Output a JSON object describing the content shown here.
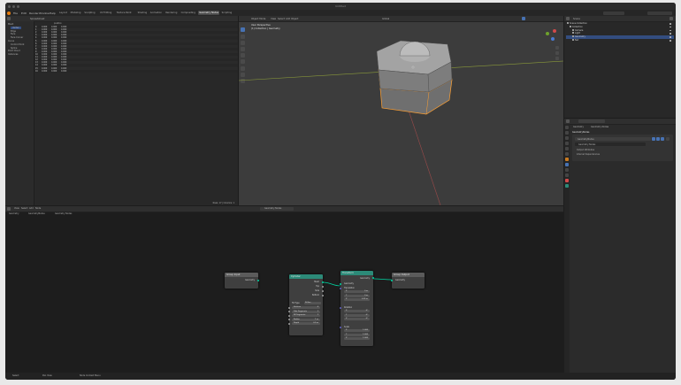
{
  "window": {
    "title": "Untitled"
  },
  "menu": [
    "File",
    "Edit",
    "Render",
    "Window",
    "Help"
  ],
  "workspaces": [
    "Layout",
    "Modeling",
    "Sculpting",
    "UV Editing",
    "Texture Paint",
    "Shading",
    "Animation",
    "Rendering",
    "Compositing",
    "Geometry Nodes",
    "Scripting"
  ],
  "active_workspace": "Geometry Nodes",
  "spreadsheet": {
    "header": "Spreadsheet",
    "items": [
      {
        "label": "Mesh",
        "indent": 0
      },
      {
        "label": "Vertex",
        "indent": 1
      },
      {
        "label": "Edge",
        "indent": 1
      },
      {
        "label": "Face",
        "indent": 1
      },
      {
        "label": "Face Corner",
        "indent": 1
      },
      {
        "label": "Curve",
        "indent": 0
      },
      {
        "label": "Control Point",
        "indent": 1
      },
      {
        "label": "Spline",
        "indent": 1
      },
      {
        "label": "Point Cloud",
        "indent": 0
      },
      {
        "label": "Instances",
        "indent": 0
      }
    ],
    "column_header": "position",
    "rows": [
      [
        "0",
        "0.000",
        "0.000",
        "0.000"
      ],
      [
        "1",
        "0.000",
        "0.000",
        "0.000"
      ],
      [
        "2",
        "0.000",
        "0.000",
        "0.000"
      ],
      [
        "3",
        "0.000",
        "0.000",
        "0.000"
      ],
      [
        "4",
        "0.000",
        "0.000",
        "0.000"
      ],
      [
        "5",
        "0.000",
        "0.000",
        "0.000"
      ],
      [
        "6",
        "0.000",
        "0.000",
        "0.000"
      ],
      [
        "7",
        "0.000",
        "0.000",
        "0.000"
      ],
      [
        "8",
        "0.000",
        "0.000",
        "0.000"
      ],
      [
        "9",
        "0.000",
        "0.000",
        "0.000"
      ],
      [
        "10",
        "0.000",
        "0.000",
        "0.000"
      ],
      [
        "11",
        "0.000",
        "0.000",
        "0.000"
      ],
      [
        "12",
        "0.000",
        "0.000",
        "0.000"
      ],
      [
        "13",
        "0.000",
        "0.000",
        "0.000"
      ],
      [
        "14",
        "0.000",
        "0.000",
        "0.000"
      ],
      [
        "15",
        "0.000",
        "0.000",
        "0.000"
      ],
      [
        "16",
        "0.000",
        "0.000",
        "0.000"
      ]
    ],
    "footer": "Rows: 17 | Columns: 1"
  },
  "viewport": {
    "mode": "Object Mode",
    "menus": [
      "View",
      "Select",
      "Add",
      "Object"
    ],
    "info_line1": "User Perspective",
    "info_line2": "(1) Collection | Geometry",
    "global_label": "Global"
  },
  "outliner": {
    "header": "Scene",
    "rows": [
      {
        "label": "Scene Collection",
        "indent": 0,
        "sel": false
      },
      {
        "label": "Collection",
        "indent": 1,
        "sel": false
      },
      {
        "label": "Camera",
        "indent": 2,
        "sel": false
      },
      {
        "label": "Light",
        "indent": 2,
        "sel": false
      },
      {
        "label": "Geometry",
        "indent": 2,
        "sel": true
      },
      {
        "label": "Nut",
        "indent": 2,
        "sel": false
      }
    ]
  },
  "properties": {
    "tabs": [
      "Geometry",
      "Geometry Nodes"
    ],
    "modifier_name": "GeometryNodes",
    "node_group": "Geometry Nodes",
    "output_attributes": "Output Attributes",
    "internal_dependencies": "Internal Dependencies",
    "panel_title": "GeometryNodes"
  },
  "node_editor": {
    "menus": [
      "View",
      "Select",
      "Add",
      "Node"
    ],
    "breadcrumbs": [
      "Geometry",
      "GeometryNodes",
      "Geometry Nodes"
    ],
    "group_name": "Geometry Nodes",
    "nodes": {
      "group_input": {
        "title": "Group Input",
        "out": "Geometry"
      },
      "cylinder": {
        "title": "Cylinder",
        "outputs": [
          "Mesh",
          "Top",
          "Side",
          "Bottom"
        ],
        "fill_type_label": "Fill Type",
        "fill_type": "N-Gon",
        "fields": [
          [
            "Vertices",
            "6"
          ],
          [
            "Side Segments",
            "1"
          ],
          [
            "Fill Segments",
            "1"
          ],
          [
            "Radius",
            "1 m"
          ],
          [
            "Depth",
            "0.5 m"
          ]
        ]
      },
      "transform": {
        "title": "Transform",
        "out": "Geometry",
        "in": "Geometry",
        "translation": {
          "label": "Translation",
          "x": "0 m",
          "y": "0 m",
          "z": "0.25 m"
        },
        "rotation": {
          "label": "Rotation",
          "x": "0°",
          "y": "0°",
          "z": "0°"
        },
        "scale": {
          "label": "Scale",
          "x": "1.000",
          "y": "1.000",
          "z": "1.000"
        }
      },
      "group_output": {
        "title": "Group Output",
        "in": "Geometry"
      }
    }
  },
  "status_bar": {
    "left": "Select",
    "middle": "Pan View",
    "right": "Node Context Menu"
  },
  "colors": {
    "accent": "#4772b3",
    "geo_socket": "#00d6a3",
    "node_geo_header": "#2c8a78",
    "selected": "#ffa032"
  }
}
